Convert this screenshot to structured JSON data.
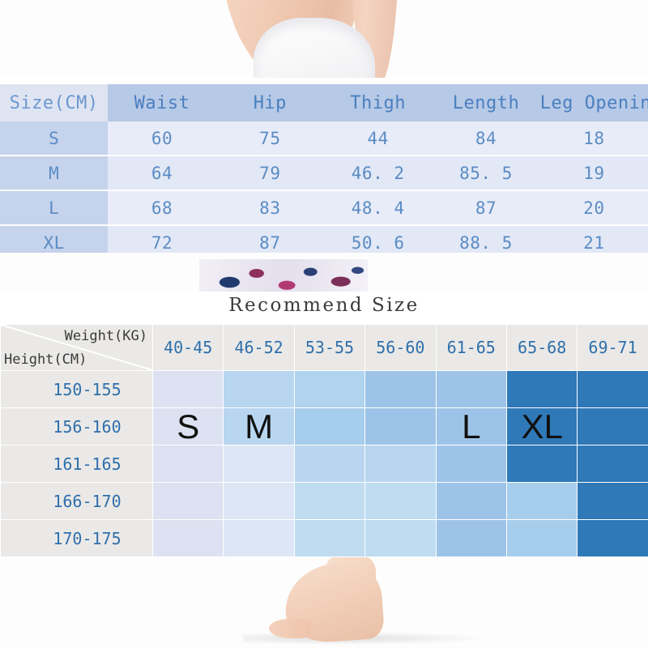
{
  "photos": {
    "top_alt": "model-torso-waist-white-leggings",
    "middle_alt": "legging-floral-print-detail",
    "bottom_alt": "model-bare-foot"
  },
  "size_table": {
    "headers": [
      "Size(CM)",
      "Waist",
      "Hip",
      "Thigh",
      "Length",
      "Leg Opening"
    ],
    "rows": [
      {
        "size": "S",
        "waist": "60",
        "hip": "75",
        "thigh": "44",
        "length": "84",
        "leg_opening": "18"
      },
      {
        "size": "M",
        "waist": "64",
        "hip": "79",
        "thigh": "46. 2",
        "length": "85. 5",
        "leg_opening": "19"
      },
      {
        "size": "L",
        "waist": "68",
        "hip": "83",
        "thigh": "48. 4",
        "length": "87",
        "leg_opening": "20"
      },
      {
        "size": "XL",
        "waist": "72",
        "hip": "87",
        "thigh": "50. 6",
        "length": "88. 5",
        "leg_opening": "21"
      }
    ]
  },
  "recommend": {
    "title": "Recommend Size",
    "axis_weight_label": "Weight(KG)",
    "axis_height_label": "Height(CM)",
    "weight_columns": [
      "40-45",
      "46-52",
      "53-55",
      "56-60",
      "61-65",
      "65-68",
      "69-71"
    ],
    "height_rows": [
      "150-155",
      "156-160",
      "161-165",
      "166-170",
      "170-175"
    ],
    "size_letters": [
      {
        "label": "S",
        "row": 1,
        "col": 0
      },
      {
        "label": "M",
        "row": 1,
        "col": 1
      },
      {
        "label": "L",
        "row": 1,
        "col": 4
      },
      {
        "label": "XL",
        "row": 1,
        "col": 5
      }
    ],
    "cell_colors": [
      [
        "#dde2f2",
        "#b8d6ef",
        "#b0d3ee",
        "#9dc4e8",
        "#9dc4e8",
        "#2f79b8",
        "#2f79b8"
      ],
      [
        "#dde2f2",
        "#b8d6ef",
        "#a7cdec",
        "#9dc4e8",
        "#9dc4e8",
        "#2f79b8",
        "#2f79b8"
      ],
      [
        "#dde2f2",
        "#dde6f5",
        "#b8d6ef",
        "#b8d6ef",
        "#9dc4e8",
        "#2f79b8",
        "#2f79b8"
      ],
      [
        "#dde2f2",
        "#dde6f5",
        "#bfdcf1",
        "#bfdcf1",
        "#9dc4e8",
        "#a7cdec",
        "#2f79b8"
      ],
      [
        "#dde2f2",
        "#dde6f5",
        "#bfdcf1",
        "#bfdcf1",
        "#9dc4e8",
        "#a7cdec",
        "#2f79b8"
      ]
    ]
  },
  "colors": {
    "accent_blue": "#2f6fab",
    "header_blue": "#b6c9e6",
    "label_blue": "#c5d3ec",
    "row_light": "#e8ecf8",
    "row_dark": "#e2e8f6",
    "grid_header_gray": "#eae9e7",
    "deep_blue": "#2f79b8",
    "page_background": "#ffffff"
  }
}
